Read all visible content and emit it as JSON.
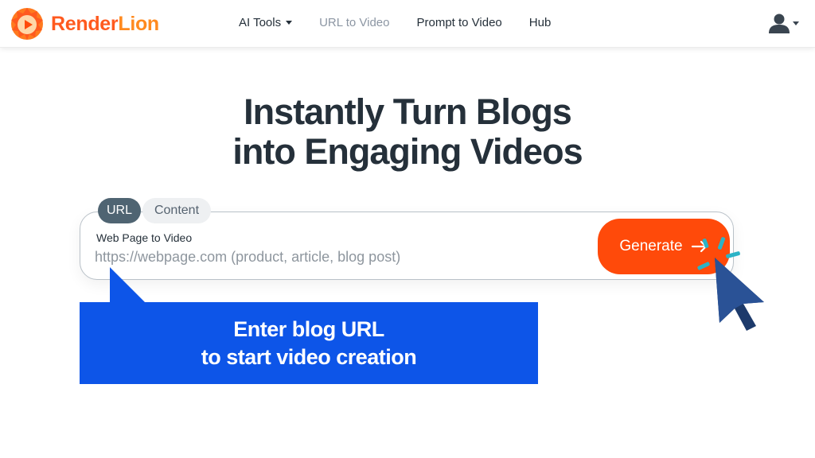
{
  "header": {
    "brand": {
      "part1": "Render",
      "part2": "Lion"
    },
    "nav": [
      {
        "label": "AI Tools",
        "has_dropdown": true
      },
      {
        "label": "URL to Video",
        "muted": true
      },
      {
        "label": "Prompt to Video"
      },
      {
        "label": "Hub"
      }
    ],
    "account_icon": "user-icon"
  },
  "hero": {
    "headline_line1": "Instantly Turn Blogs",
    "headline_line2": "into Engaging Videos"
  },
  "input_card": {
    "tabs": [
      {
        "label": "URL",
        "active": true
      },
      {
        "label": "Content",
        "active": false
      }
    ],
    "field_label": "Web Page to Video",
    "placeholder": "https://webpage.com (product, article, blog post)",
    "value": "",
    "button_label": "Generate",
    "button_icon": "arrow-right-icon"
  },
  "callout": {
    "line1": "Enter blog URL",
    "line2": "to start video creation"
  },
  "colors": {
    "brand_orange": "#ff4a0a",
    "callout_blue": "#0d55e8",
    "text_dark": "#25303a",
    "sparkle_teal": "#2bb3c6",
    "cursor_navy": "#1d3a6b"
  }
}
